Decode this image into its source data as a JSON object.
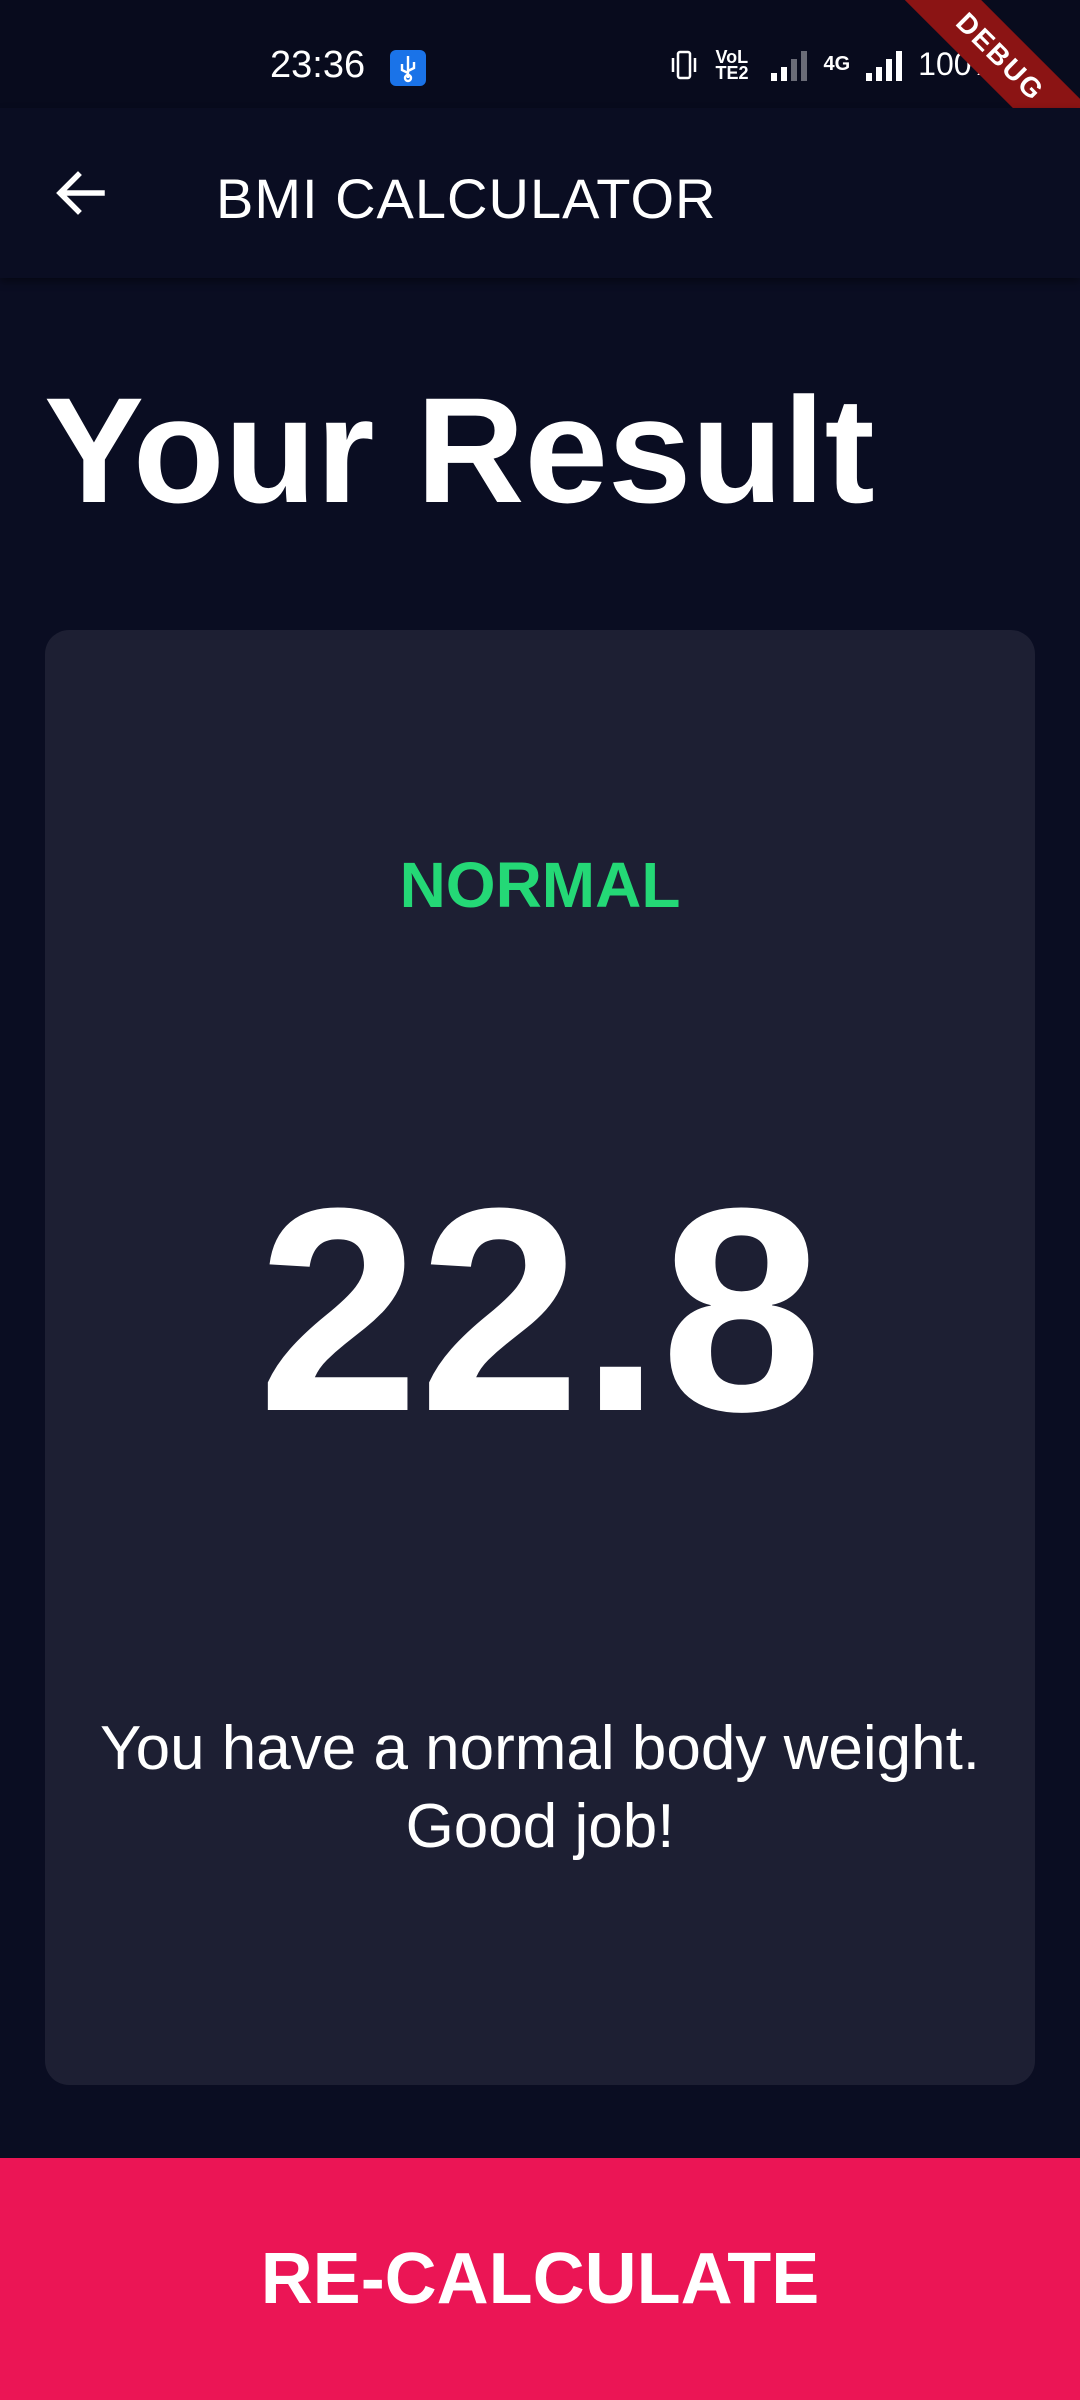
{
  "status_bar": {
    "time": "23:36",
    "battery": "100%",
    "network": "4G",
    "volte": "VoLTE2"
  },
  "debug_banner": "DEBUG",
  "app_bar": {
    "title": "BMI CALCULATOR",
    "back_icon": "arrow-left-icon"
  },
  "result": {
    "heading": "Your Result",
    "status": "NORMAL",
    "status_color": "#24d876",
    "bmi": "22.8",
    "interpretation": "You have a normal body weight. Good job!"
  },
  "button": {
    "label": "RE-CALCULATE",
    "color": "#eb1555"
  }
}
